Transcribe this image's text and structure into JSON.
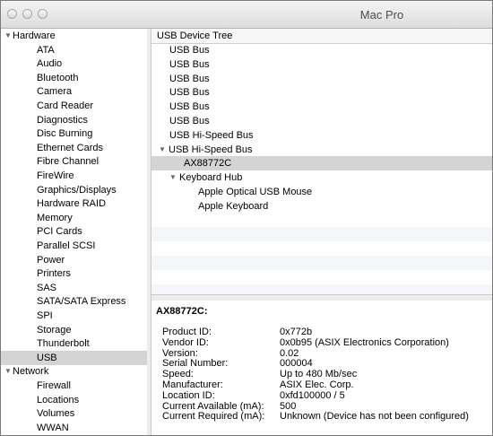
{
  "window": {
    "title": "Mac Pro"
  },
  "sidebar": {
    "items": [
      {
        "label": "Hardware",
        "level": 0,
        "expanded": true
      },
      {
        "label": "ATA",
        "level": 1
      },
      {
        "label": "Audio",
        "level": 1
      },
      {
        "label": "Bluetooth",
        "level": 1
      },
      {
        "label": "Camera",
        "level": 1
      },
      {
        "label": "Card Reader",
        "level": 1
      },
      {
        "label": "Diagnostics",
        "level": 1
      },
      {
        "label": "Disc Burning",
        "level": 1
      },
      {
        "label": "Ethernet Cards",
        "level": 1
      },
      {
        "label": "Fibre Channel",
        "level": 1
      },
      {
        "label": "FireWire",
        "level": 1
      },
      {
        "label": "Graphics/Displays",
        "level": 1
      },
      {
        "label": "Hardware RAID",
        "level": 1
      },
      {
        "label": "Memory",
        "level": 1
      },
      {
        "label": "PCI Cards",
        "level": 1
      },
      {
        "label": "Parallel SCSI",
        "level": 1
      },
      {
        "label": "Power",
        "level": 1
      },
      {
        "label": "Printers",
        "level": 1
      },
      {
        "label": "SAS",
        "level": 1
      },
      {
        "label": "SATA/SATA Express",
        "level": 1
      },
      {
        "label": "SPI",
        "level": 1
      },
      {
        "label": "Storage",
        "level": 1
      },
      {
        "label": "Thunderbolt",
        "level": 1
      },
      {
        "label": "USB",
        "level": 1,
        "selected": true
      },
      {
        "label": "Network",
        "level": 0,
        "expanded": true
      },
      {
        "label": "Firewall",
        "level": 1
      },
      {
        "label": "Locations",
        "level": 1
      },
      {
        "label": "Volumes",
        "level": 1
      },
      {
        "label": "WWAN",
        "level": 1
      }
    ]
  },
  "tree": {
    "header": "USB Device Tree",
    "rows": [
      {
        "label": "USB Bus",
        "level": 0
      },
      {
        "label": "USB Bus",
        "level": 0
      },
      {
        "label": "USB Bus",
        "level": 0
      },
      {
        "label": "USB Bus",
        "level": 0
      },
      {
        "label": "USB Bus",
        "level": 0
      },
      {
        "label": "USB Bus",
        "level": 0
      },
      {
        "label": "USB Hi-Speed Bus",
        "level": 0
      },
      {
        "label": "USB Hi-Speed Bus",
        "level": 0,
        "expanded": true
      },
      {
        "label": "AX88772C",
        "level": 1,
        "selected": true
      },
      {
        "label": "Keyboard Hub",
        "level": 1,
        "expanded": true
      },
      {
        "label": "Apple Optical USB Mouse",
        "level": 2
      },
      {
        "label": "Apple Keyboard",
        "level": 2
      }
    ]
  },
  "detail": {
    "title": "AX88772C:",
    "properties": [
      {
        "key": "Product ID:",
        "value": "0x772b"
      },
      {
        "key": "Vendor ID:",
        "value": "0x0b95  (ASIX Electronics Corporation)"
      },
      {
        "key": "Version:",
        "value": " 0.02"
      },
      {
        "key": "Serial Number:",
        "value": "000004"
      },
      {
        "key": "Speed:",
        "value": "Up to 480 Mb/sec"
      },
      {
        "key": "Manufacturer:",
        "value": "ASIX Elec. Corp."
      },
      {
        "key": "Location ID:",
        "value": "0xfd100000 / 5"
      },
      {
        "key": "Current Available (mA):",
        "value": "500"
      },
      {
        "key": "Current Required (mA):",
        "value": "Unknown (Device has not been configured)"
      }
    ]
  }
}
